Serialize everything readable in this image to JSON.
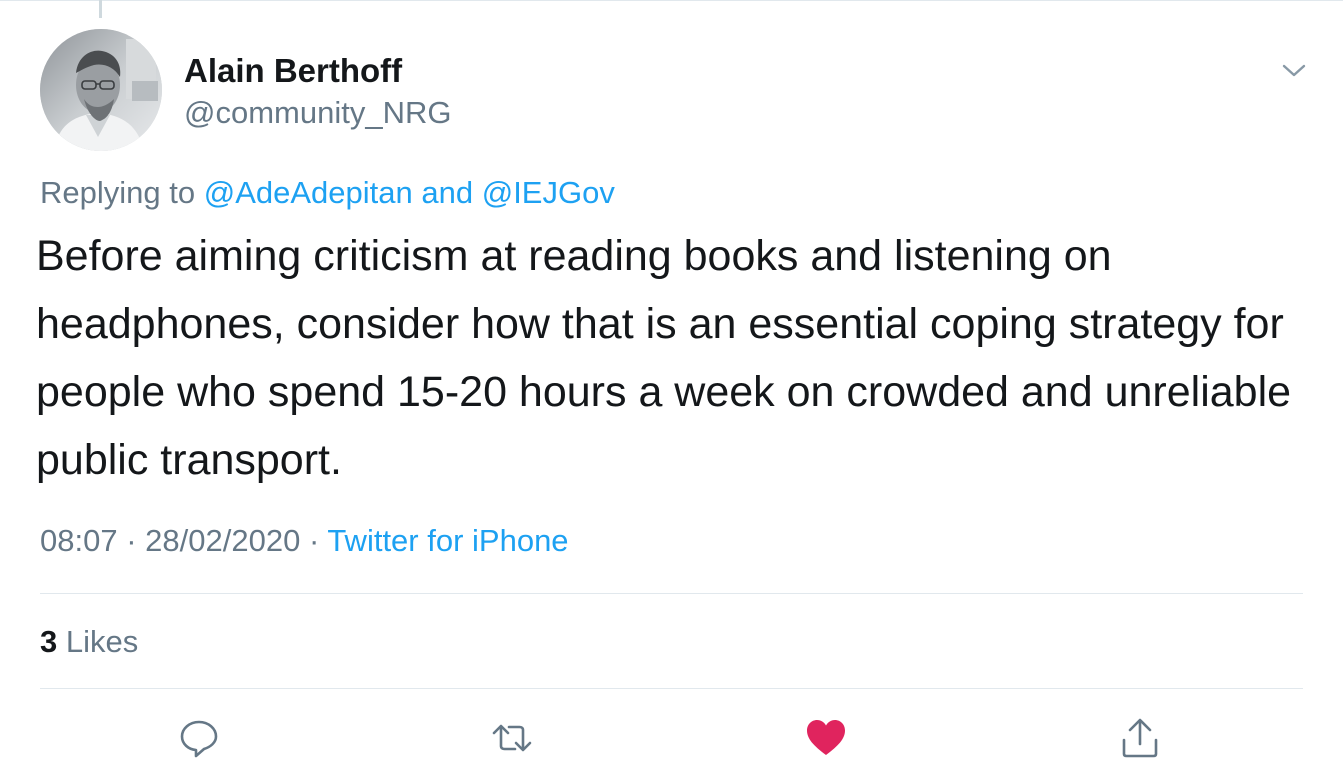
{
  "author": {
    "display_name": "Alain Berthoff",
    "handle": "@community_NRG"
  },
  "reply": {
    "prefix": "Replying to",
    "mention_1": "@AdeAdepitan",
    "conjunction": "and",
    "mention_2": "@IEJGov"
  },
  "tweet": {
    "text": "Before aiming criticism at reading books and listening on headphones, consider how that is an essential coping strategy for people who spend 15-20 hours a week on crowded and unreliable public transport.",
    "time": "08:07",
    "date": "28/02/2020",
    "source": "Twitter for iPhone"
  },
  "stats": {
    "likes_count": "3",
    "likes_label": "Likes"
  },
  "actions": {
    "reply_icon": "comment-icon",
    "retweet_icon": "retweet-icon",
    "like_icon": "heart-icon",
    "share_icon": "share-icon",
    "liked": true
  },
  "colors": {
    "link": "#1da1f2",
    "secondary_text": "#657786",
    "like_active": "#e0245e"
  }
}
